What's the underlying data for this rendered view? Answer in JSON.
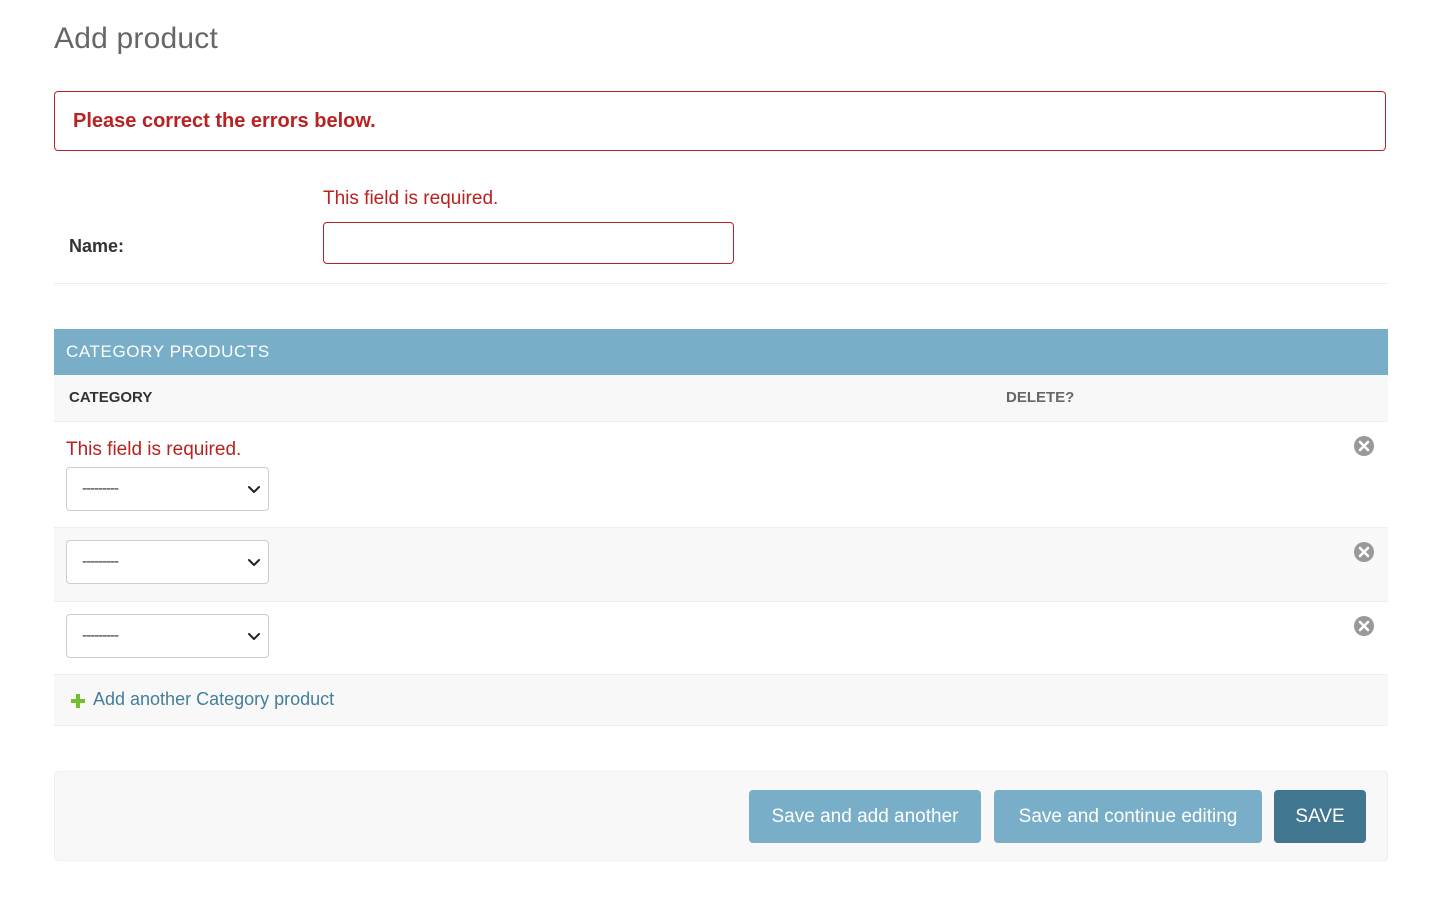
{
  "page": {
    "title": "Add product"
  },
  "errornote": "Please correct the errors below.",
  "name_field": {
    "error": "This field is required.",
    "label": "Name:",
    "value": ""
  },
  "inline": {
    "header": "CATEGORY PRODUCTS",
    "columns": {
      "category": "CATEGORY",
      "delete": "DELETE?"
    },
    "rows": [
      {
        "error": "This field is required.",
        "category_value": "---------"
      },
      {
        "error": "",
        "category_value": "---------"
      },
      {
        "error": "",
        "category_value": "---------"
      }
    ],
    "add_link": "Add another Category product"
  },
  "submit": {
    "save_add_another": "Save and add another",
    "save_continue": "Save and continue editing",
    "save": "SAVE"
  },
  "icons": {
    "delete": "delete-x-circle-icon",
    "add": "plus-icon",
    "chevron": "chevron-down-icon"
  },
  "colors": {
    "error": "#ba2121",
    "header": "#79aec8",
    "save": "#417690",
    "link": "#447e9b",
    "add_icon": "#70bf2b"
  }
}
